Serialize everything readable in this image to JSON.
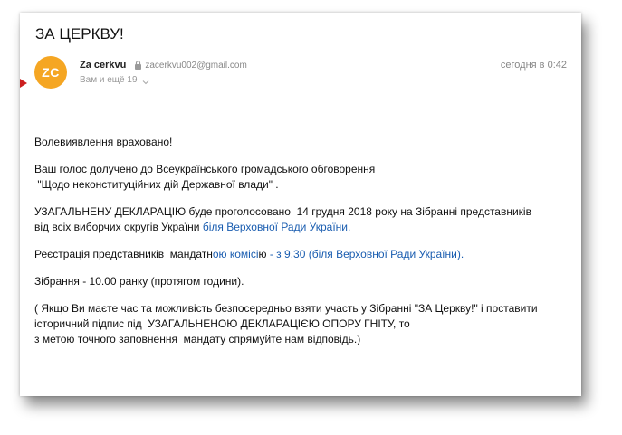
{
  "message": {
    "subject": "ЗА ЦЕРКВУ!",
    "sender": {
      "avatar_initials": "ZC",
      "name": "Za cerkvu",
      "email": "zacerkvu002@gmail.com",
      "recipients": "Вам и ещё 19",
      "date": "сегодня в 0:42"
    },
    "body": {
      "p1": "Волевиявлення враховано!",
      "p2_line1": "Ваш голос долучено до Всеукраїнського громадського обговорення",
      "p2_line2": " \"Щодо неконституційних дій Державної влади\" .",
      "p3_line1": "УЗАГАЛЬНЕНУ ДЕКЛАРАЦІЮ буде проголосовано  14 грудня 2018 року на Зібранні представників",
      "p3_line2_text": "від всіх виборчих округів України ",
      "p3_line2_link": "біля Верховної Ради України.",
      "p4_text1": "Реєстрація представників  мандатн",
      "p4_link1": "ою комісі",
      "p4_text2": "ю",
      "p4_link2": " - з 9.30 (біля Верховної Ради України).",
      "p5": "Зібрання - 10.00 ранку (протягом години).",
      "p6_line1": "( Якщо Ви маєте час та можливість безпосередньо взяти участь у Зібранні \"ЗА Церкву!\" і поставити",
      "p6_line2": "історичний підпис під  УЗАГАЛЬНЕНОЮ ДЕКЛАРАЦІЄЮ ОПОРУ ГНІТУ, то",
      "p6_line3": "з метою точного заповнення  мандату спрямуйте нам відповідь.)"
    }
  },
  "colors": {
    "avatar_bg": "#f5a623",
    "link": "#1a5db0",
    "pointer": "#cc1f1f"
  },
  "icons": [
    "lock-icon",
    "chevron-down-icon"
  ]
}
